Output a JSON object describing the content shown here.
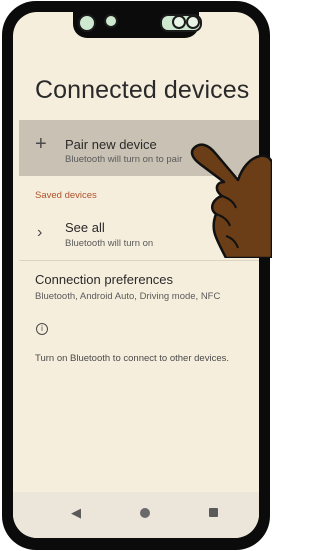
{
  "page": {
    "title": "Connected devices"
  },
  "pair_new_device": {
    "icon": "plus-icon",
    "title": "Pair new device",
    "subtitle": "Bluetooth will turn on to pair"
  },
  "saved_devices": {
    "section_label": "Saved devices",
    "see_all": {
      "icon": "chevron-right-icon",
      "title": "See all",
      "subtitle": "Bluetooth will turn on"
    }
  },
  "connection_preferences": {
    "title": "Connection preferences",
    "subtitle": "Bluetooth, Android Auto, Driving mode, NFC"
  },
  "info": {
    "icon": "info-icon",
    "text": "Turn on Bluetooth to connect to other devices."
  },
  "navigation_bar": {
    "back_icon": "back-triangle-icon",
    "home_icon": "home-circle-icon",
    "recents_icon": "recents-square-icon"
  },
  "overlay": {
    "icon": "pointing-hand-icon"
  },
  "colors": {
    "background": "#f6eedd",
    "highlight_row": "#c9c2b4",
    "section_accent": "#b0522a",
    "navbar": "#ece6da",
    "hand": "#6b3e17"
  }
}
